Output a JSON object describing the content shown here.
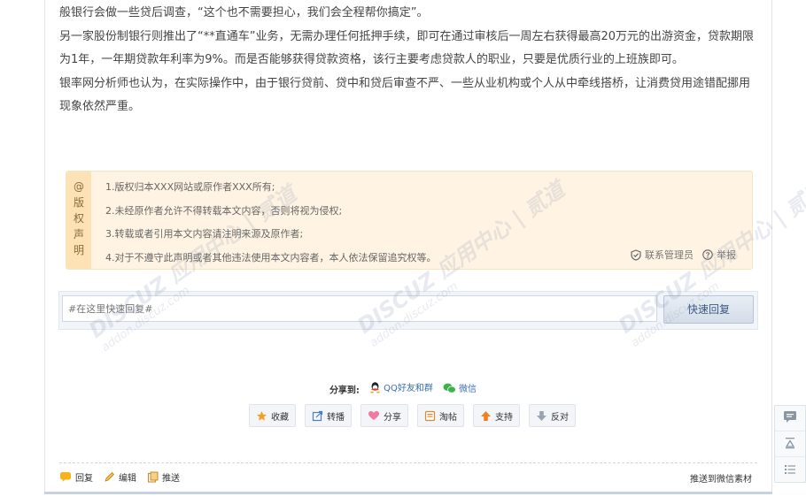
{
  "article": {
    "paragraphs": [
      "般银行会做一些贷后调查，“这个也不需要担心，我们会全程帮你搞定”。",
      "另一家股份制银行则推出了“**直通车”业务，无需办理任何抵押手续，即可在通过审核后一周左右获得最高20万元的出游资金，贷款期限为1年，一年期贷款年利率为9%。而是否能够获得贷款资格，该行主要考虑贷款人的职业，只要是优质行业的上班族即可。",
      "银率网分析师也认为，在实际操作中，由于银行贷前、贷中和贷后审查不严、一些从业机构或个人从中牵线搭桥，让消费贷用途错配挪用现象依然严重。"
    ]
  },
  "copyright": {
    "tag": [
      "@",
      "版",
      "权",
      "声",
      "明"
    ],
    "items": [
      "1.版权归本XXX网站或原作者XXX所有;",
      "2.未经原作者允许不得转载本文内容，否则将视为侵权;",
      "3.转载或者引用本文内容请注明来源及原作者;",
      "4.对于不遵守此声明或者其他违法使用本文内容者，本人依法保留追究权等。"
    ],
    "contact_label": "联系管理员",
    "report_label": "举报",
    "contact_icon": "shield-check-icon",
    "report_icon": "question-icon"
  },
  "reply": {
    "placeholder": "#在这里快速回复#",
    "button_label": "快速回复"
  },
  "share": {
    "label": "分享到:",
    "items": [
      {
        "label": "QQ好友和群",
        "icon": "qq-icon"
      },
      {
        "label": "微信",
        "icon": "wechat-icon"
      }
    ]
  },
  "actions": [
    {
      "label": "收藏",
      "icon": "star-icon",
      "color": "#f0a020"
    },
    {
      "label": "转播",
      "icon": "forward-icon",
      "color": "#4a7fc0"
    },
    {
      "label": "分享",
      "icon": "heart-icon",
      "color": "#f07aa0"
    },
    {
      "label": "淘帖",
      "icon": "collection-icon",
      "color": "#e08a30"
    },
    {
      "label": "支持",
      "icon": "thumb-up-icon",
      "color": "#f08020"
    },
    {
      "label": "反对",
      "icon": "thumb-down-icon",
      "color": "#9aa4b0"
    }
  ],
  "bottom": {
    "left": [
      {
        "label": "回复",
        "icon": "reply-bubble-icon"
      },
      {
        "label": "编辑",
        "icon": "pencil-icon"
      },
      {
        "label": "推送",
        "icon": "push-icon"
      }
    ],
    "right_label": "推送到微信素材"
  },
  "side_tools": [
    "comment-icon",
    "back-to-top-icon",
    "list-icon"
  ],
  "watermark": {
    "brand": "DISCUZ 应用中心 | 贰道",
    "site": "addon.discuz.com"
  }
}
